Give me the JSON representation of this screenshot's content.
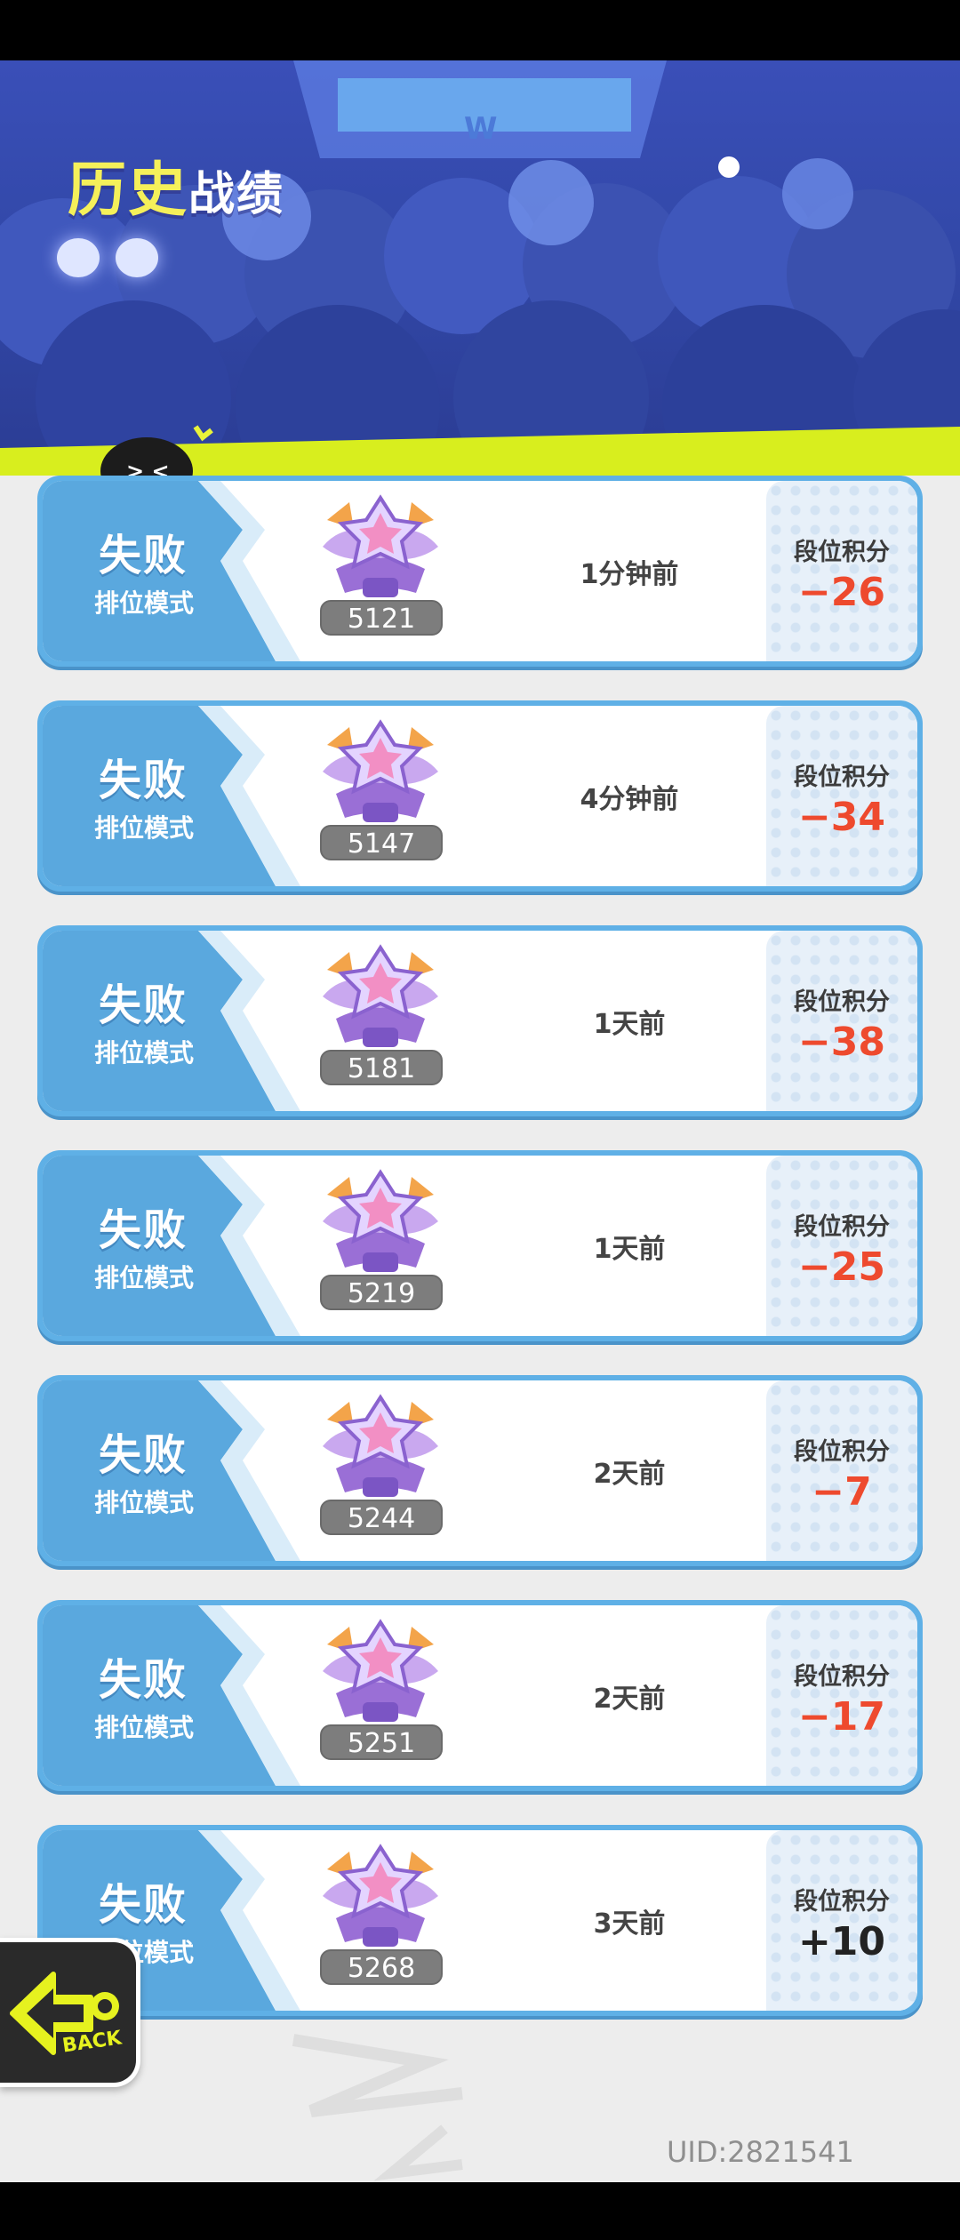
{
  "header": {
    "title_part1": "历史",
    "title_part2": "战绩"
  },
  "records": [
    {
      "result": "失败",
      "mode": "排位模式",
      "rank_points": "5121",
      "time": "1分钟前",
      "score_label": "段位积分",
      "score_change": "−26"
    },
    {
      "result": "失败",
      "mode": "排位模式",
      "rank_points": "5147",
      "time": "4分钟前",
      "score_label": "段位积分",
      "score_change": "−34"
    },
    {
      "result": "失败",
      "mode": "排位模式",
      "rank_points": "5181",
      "time": "1天前",
      "score_label": "段位积分",
      "score_change": "−38"
    },
    {
      "result": "失败",
      "mode": "排位模式",
      "rank_points": "5219",
      "time": "1天前",
      "score_label": "段位积分",
      "score_change": "−25"
    },
    {
      "result": "失败",
      "mode": "排位模式",
      "rank_points": "5244",
      "time": "2天前",
      "score_label": "段位积分",
      "score_change": "−7"
    },
    {
      "result": "失败",
      "mode": "排位模式",
      "rank_points": "5251",
      "time": "2天前",
      "score_label": "段位积分",
      "score_change": "−17"
    },
    {
      "result": "失败",
      "mode": "排位模式",
      "rank_points": "5268",
      "time": "3天前",
      "score_label": "段位积分",
      "score_change": "+10"
    }
  ],
  "back_button": {
    "label": "BACK",
    "icon": "arrow-left-icon"
  },
  "footer": {
    "uid": "UID:2821541"
  },
  "colors": {
    "loss": "#ee4a2e",
    "gain": "#222222",
    "card_blue": "#5aa8de",
    "title_yellow": "#f5f05a"
  }
}
